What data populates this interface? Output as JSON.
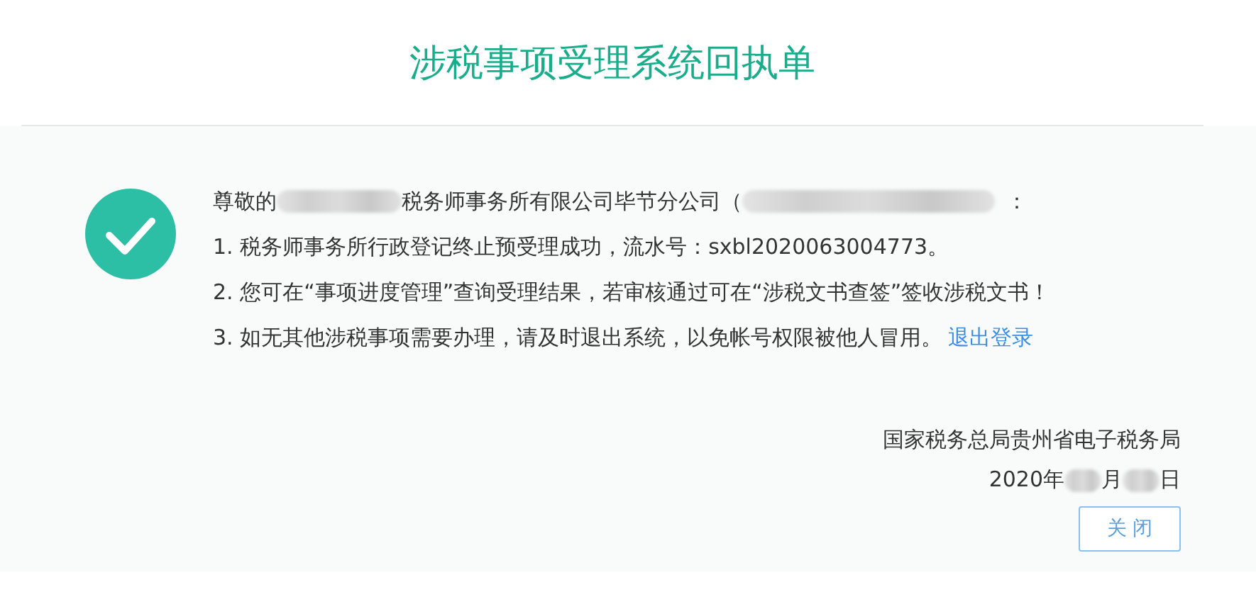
{
  "title": "涉税事项受理系统回执单",
  "greeting": {
    "prefix": "尊敬的",
    "middle": "税务师事务所有限公司毕节分公司（",
    "suffix": "："
  },
  "lines": [
    "1. 税务师事务所行政登记终止预受理成功，流水号：sxbl2020063004773。",
    "2. 您可在“事项进度管理”查询受理结果，若审核通过可在“涉税文书查签”签收涉税文书！",
    "3. 如无其他涉税事项需要办理，请及时退出系统，以免帐号权限被他人冒用。"
  ],
  "logout_link": "退出登录",
  "signature": "国家税务总局贵州省电子税务局",
  "date": {
    "year": "2020年",
    "month": "月",
    "day": "日"
  },
  "close_button": "关 闭"
}
